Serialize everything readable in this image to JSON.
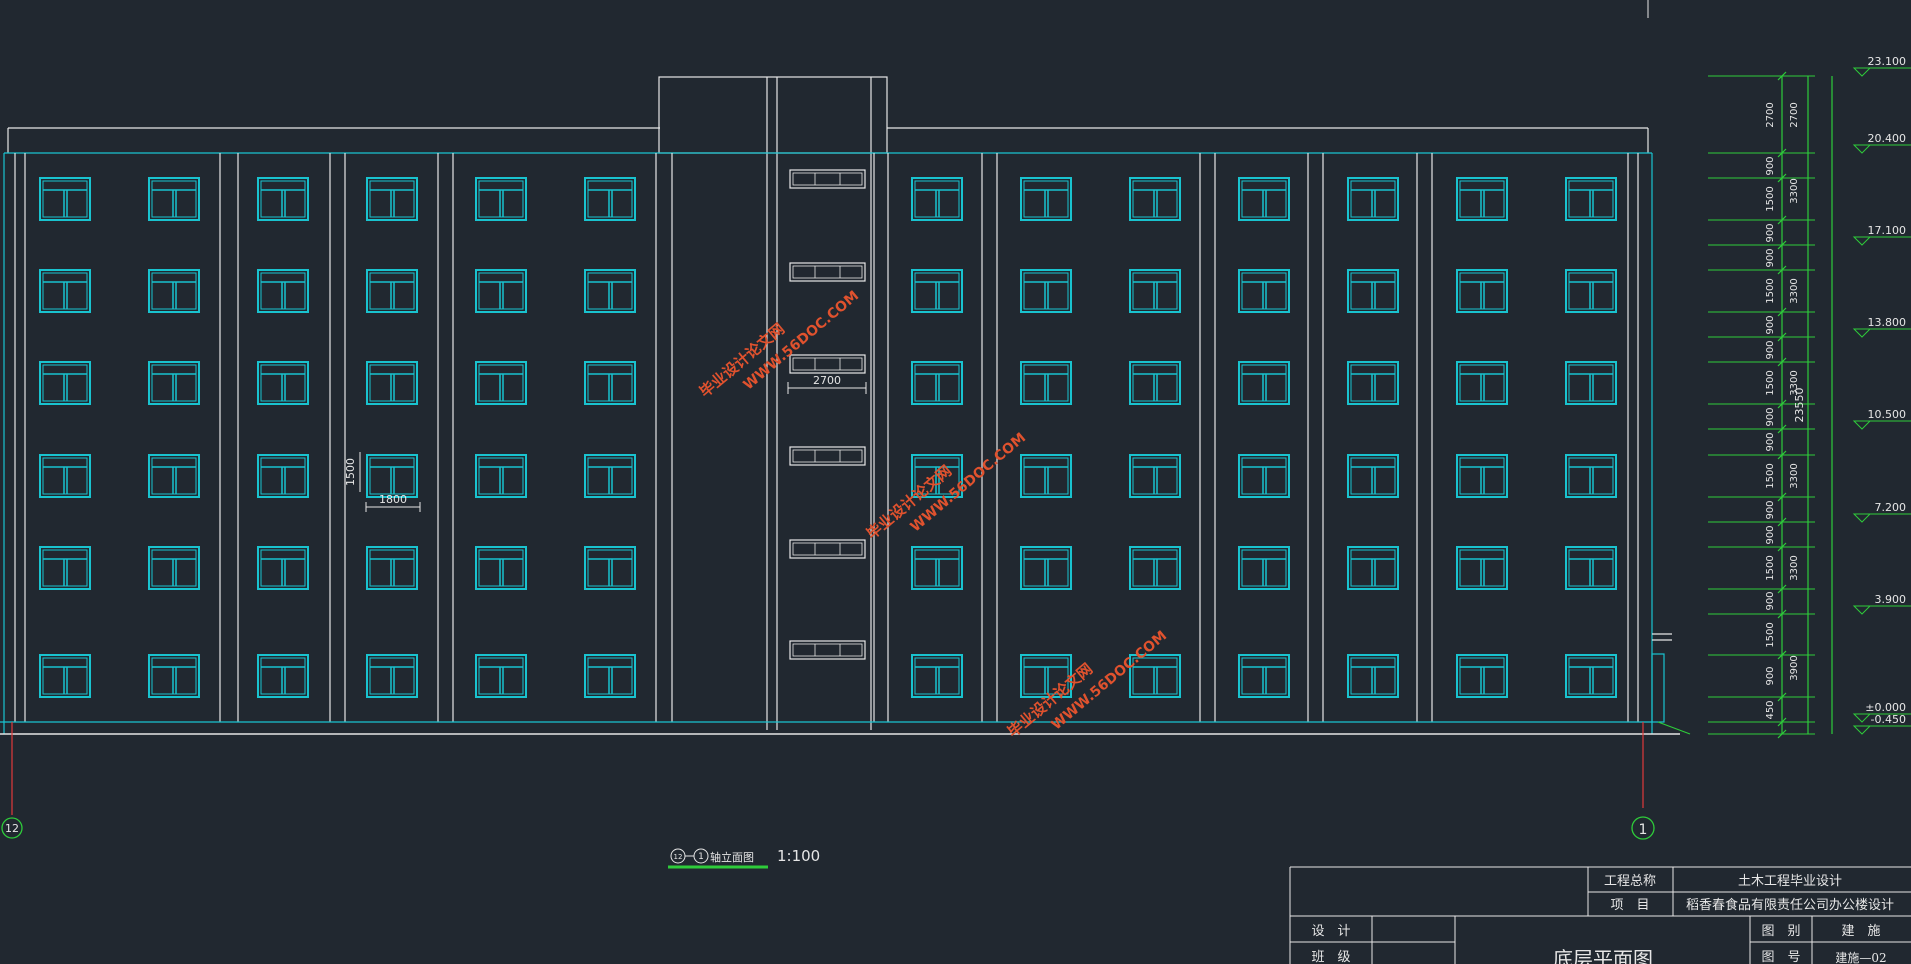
{
  "colors": {
    "background": "#212830",
    "line": "#e6e6e6",
    "window": "#19c3cf",
    "dimension": "#2ecc3a",
    "axis_red": "#e03a3a",
    "watermark": "#e0522e"
  },
  "elevation": {
    "levels": [
      "23.100",
      "20.400",
      "17.100",
      "13.800",
      "10.500",
      "7.200",
      "3.900",
      "±0.000",
      "-0.450"
    ],
    "dims_outer": [
      "2700",
      "900",
      "1500",
      "900",
      "900",
      "1500",
      "900",
      "900",
      "1500",
      "900",
      "900",
      "1500",
      "900",
      "900",
      "1500",
      "900",
      "1500",
      "900",
      "450"
    ],
    "dims_inner": [
      "2700",
      "3300",
      "3300",
      "3300",
      "3300",
      "3300",
      "3900"
    ],
    "total_height": "23550",
    "win_height": "1500",
    "win_width": "1800",
    "stair_width": "2700"
  },
  "axes": {
    "left": "12",
    "right": "1"
  },
  "caption": {
    "symbol_left": "12",
    "symbol_right": "1",
    "title": "轴立面图",
    "scale": "1:100"
  },
  "title_block": {
    "project_label": "工程总称",
    "project_value": "土木工程毕业设计",
    "item_label": "项　目",
    "item_value": "稻香春食品有限责任公司办公楼设计",
    "design_label": "设　计",
    "class_label": "班　级",
    "drawing_title": "底层平面图",
    "category_label": "图　别",
    "category_value": "建　施",
    "number_label": "图　号",
    "number_value": "建施—02"
  },
  "watermarks": [
    "毕业设计论文网",
    "WWW.56DOC.COM"
  ]
}
